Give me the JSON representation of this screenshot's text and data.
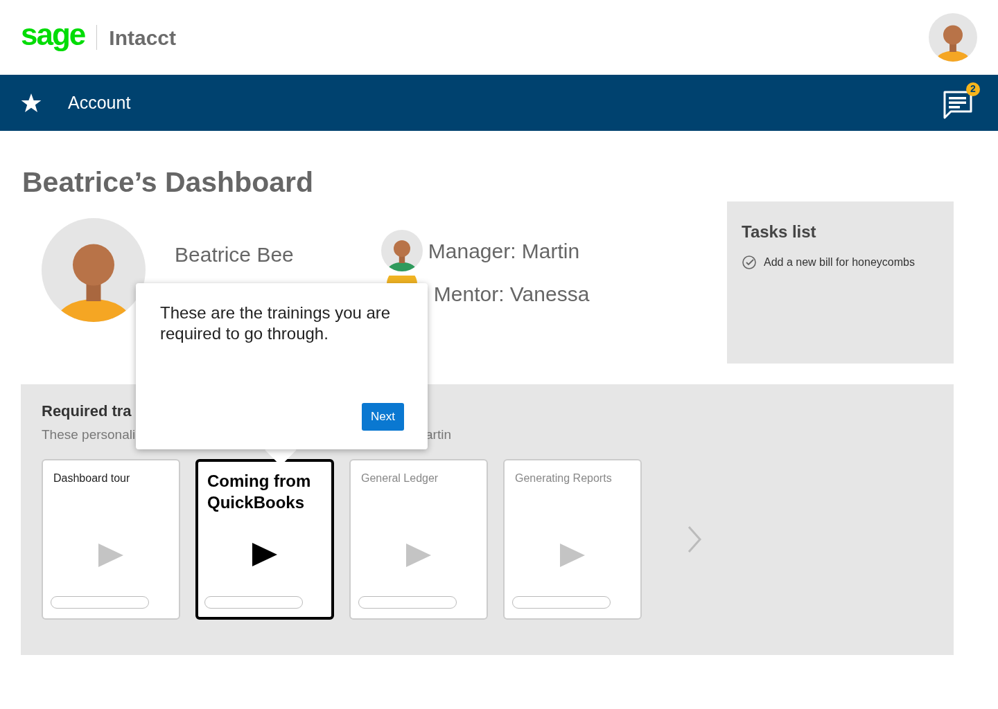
{
  "header": {
    "logo": "sage",
    "product": "Intacct"
  },
  "nav": {
    "title": "Account",
    "notifications": "2"
  },
  "page_title": "Beatrice’s Dashboard",
  "profile": {
    "name": "Beatrice Bee",
    "manager": "Manager: Martin",
    "mentor": "Mentor: Vanessa"
  },
  "tasks": {
    "title": "Tasks list",
    "items": [
      {
        "label": "Add a new bill for honeycombs"
      }
    ]
  },
  "trainings": {
    "title": "Required tra",
    "subtitle": "These personali",
    "subtitle_tail": "artin",
    "cards": [
      {
        "title": "Dashboard tour",
        "selected": false,
        "available": true
      },
      {
        "title": "Coming from QuickBooks",
        "selected": true,
        "available": true
      },
      {
        "title": "General Ledger",
        "selected": false,
        "available": false
      },
      {
        "title": "Generating Reports",
        "selected": false,
        "available": false
      }
    ]
  },
  "popover": {
    "text": "These are the trainings you are required to go through.",
    "button": "Next"
  }
}
